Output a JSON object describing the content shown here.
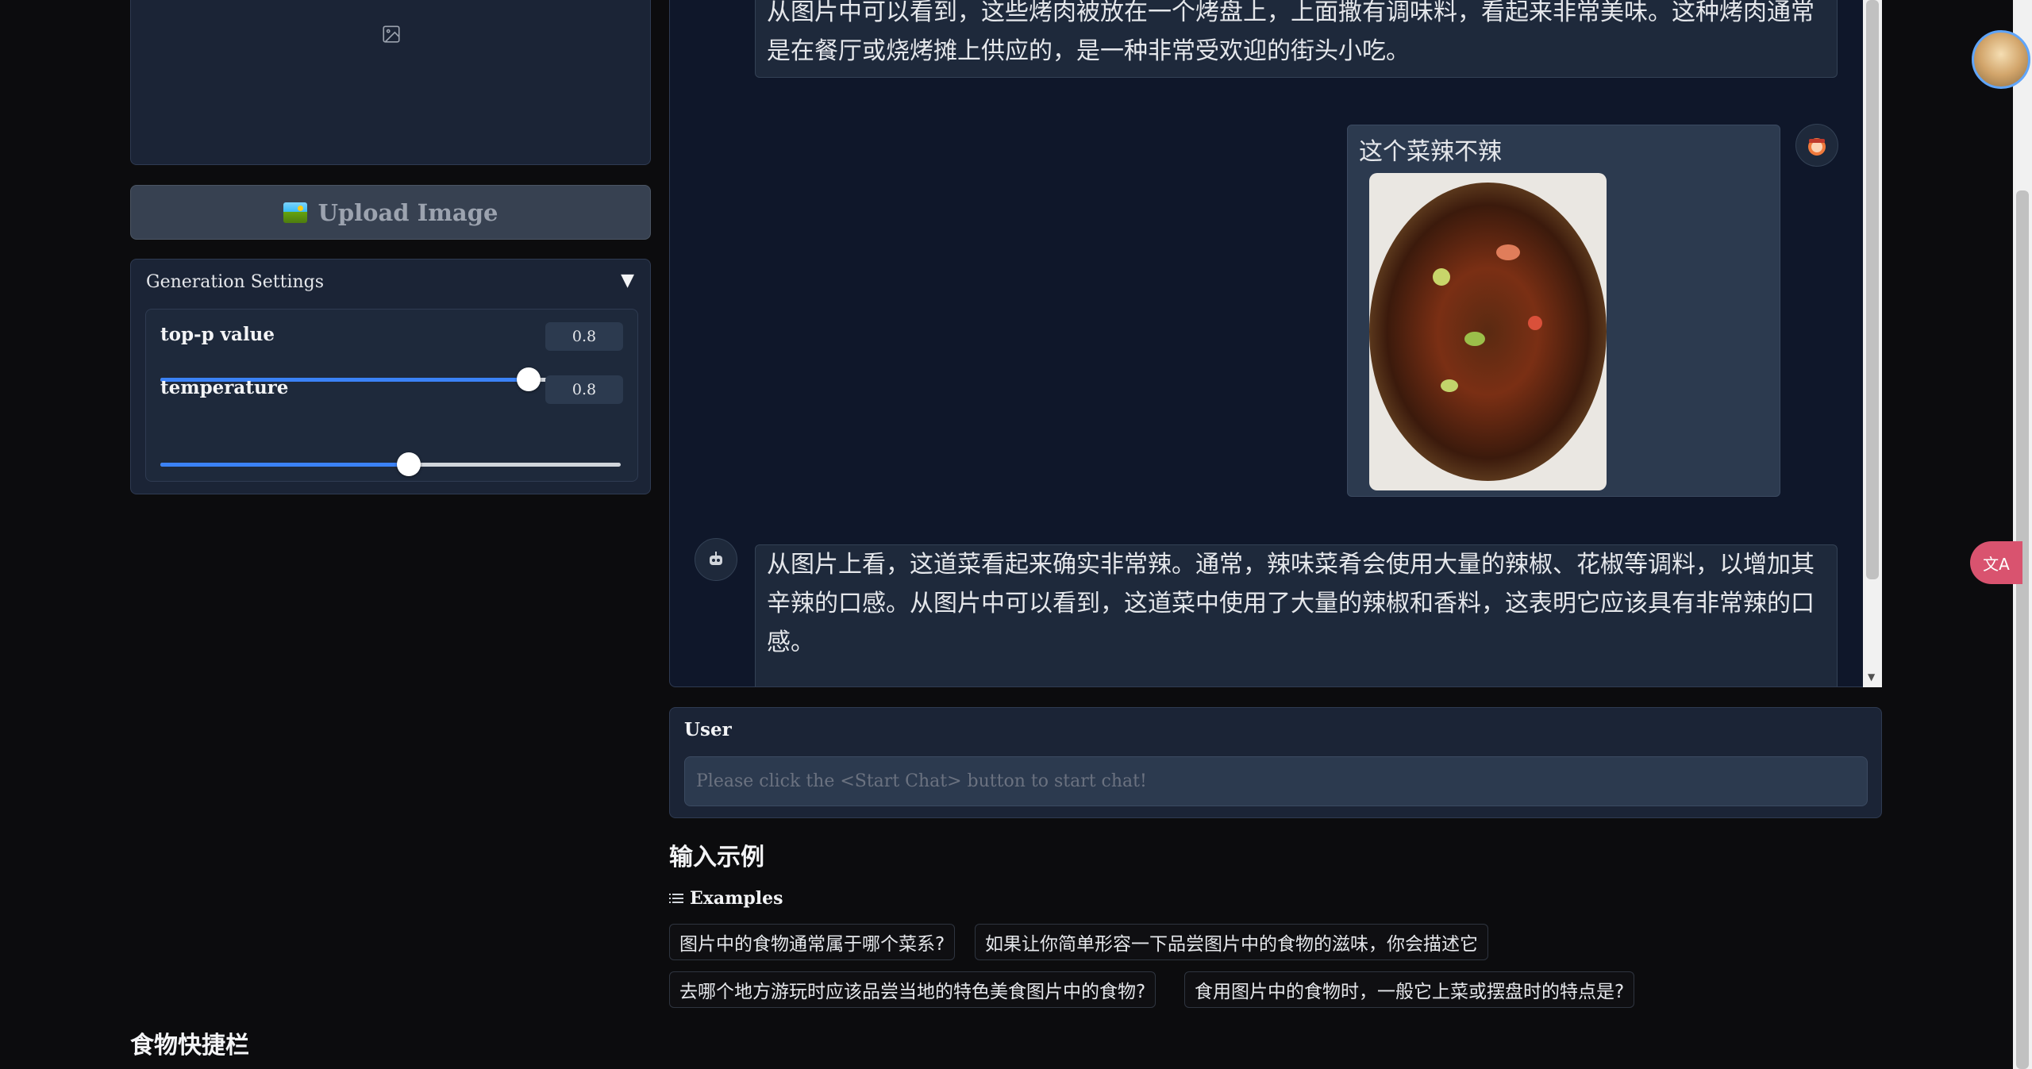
{
  "left": {
    "upload_button": "Upload Image",
    "generation_settings": {
      "title": "Generation Settings",
      "caret": "▼",
      "top_p": {
        "label": "top-p value",
        "value": "0.8",
        "fraction": 0.8
      },
      "temperature": {
        "label": "temperature",
        "value": "0.8",
        "fraction": 0.54
      }
    },
    "shortcut_title": "食物快捷栏"
  },
  "chat": {
    "msg1_text": "从图片中可以看到，这些烤肉被放在一个烤盘上，上面撒有调味料，看起来非常美味。这种烤肉通常是在餐厅或烧烤摊上供应的，是一种非常受欢迎的街头小吃。",
    "user_msg": "这个菜辣不辣",
    "msg2_text": "从图片上看，这道菜看起来确实非常辣。通常，辣味菜肴会使用大量的辣椒、花椒等调料，以增加其辛辣的口感。从图片中可以看到，这道菜中使用了大量的辣椒和香料，这表明它应该具有非常辣的口感。"
  },
  "user_panel": {
    "label": "User",
    "placeholder": "Please click the <Start Chat> button to start chat!"
  },
  "examples": {
    "heading": "输入示例",
    "label": "Examples",
    "items": [
      "图片中的食物通常属于哪个菜系?",
      "如果让你简单形容一下品尝图片中的食物的滋味，你会描述它",
      "去哪个地方游玩时应该品尝当地的特色美食图片中的食物?",
      "食用图片中的食物时，一般它上菜或摆盘时的特点是?"
    ]
  },
  "colors": {
    "accent": "#3b82f6",
    "panel": "#1b2436",
    "chat_bg": "#0f172a"
  }
}
